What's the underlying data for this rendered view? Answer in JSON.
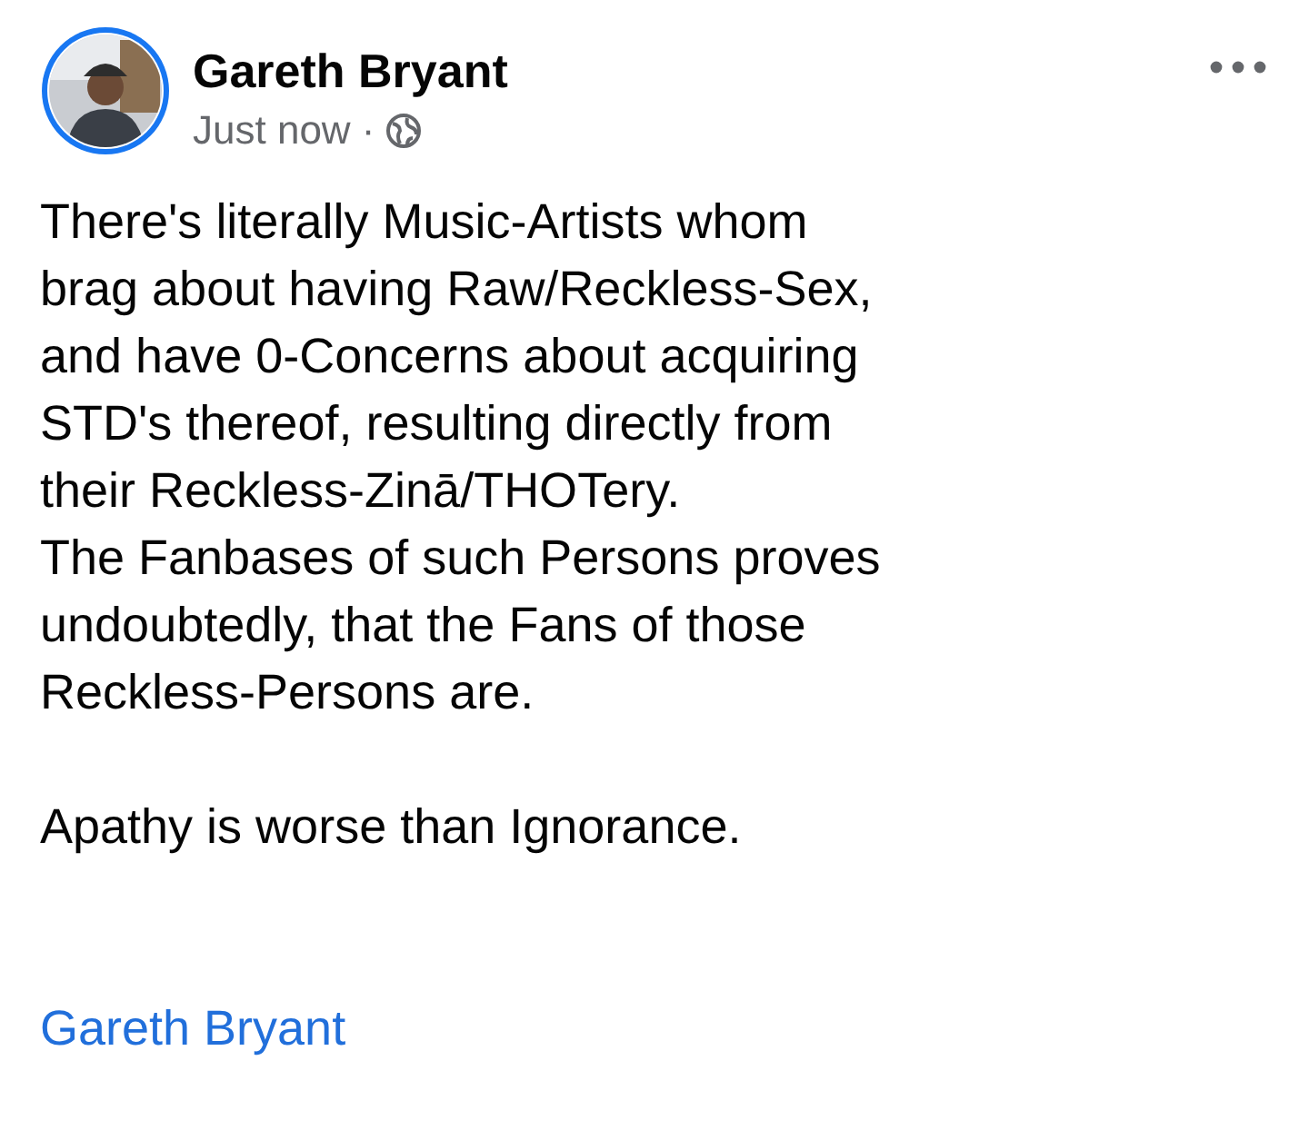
{
  "post": {
    "author": "Gareth Bryant",
    "time": "Just now",
    "separator": "·",
    "paragraphs": [
      [
        "There's literally Music-Artists whom",
        "brag about having Raw/Reckless-Sex,",
        "and have 0-Concerns about acquiring",
        "STD's thereof, resulting directly from",
        "their Reckless-Zinā/THOTery.",
        "The Fanbases of such Persons proves",
        "undoubtedly, that the Fans of those",
        "Reckless-Persons are."
      ],
      [
        "Apathy is worse than Ignorance."
      ]
    ],
    "signature": "Gareth Bryant"
  }
}
